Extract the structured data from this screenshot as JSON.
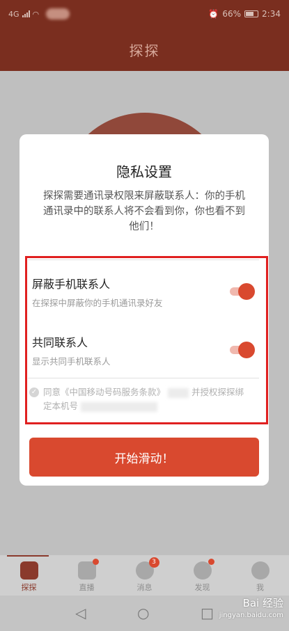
{
  "status_bar": {
    "network": "4G",
    "battery_percent": "66%",
    "time": "2:34"
  },
  "header": {
    "title": "探探"
  },
  "dialog": {
    "title": "隐私设置",
    "description": "探探需要通讯录权限来屏蔽联系人：你的手机通讯录中的联系人将不会看到你，你也看不到他们！",
    "settings": [
      {
        "label": "屏蔽手机联系人",
        "sub": "在探探中屏蔽你的手机通讯录好友",
        "enabled": true
      },
      {
        "label": "共同联系人",
        "sub": "显示共同手机联系人",
        "enabled": true
      }
    ],
    "agree_text": "同意《中国移动号码服务条款》",
    "agree_text2": "并授权探探绑",
    "agree_text3": "定本机号",
    "start_button": "开始滑动！"
  },
  "bottom_nav": [
    {
      "label": "探探",
      "icon": "cards-icon",
      "active": true
    },
    {
      "label": "直播",
      "icon": "tv-icon",
      "dot": true
    },
    {
      "label": "消息",
      "icon": "chat-icon",
      "badge": "3"
    },
    {
      "label": "发现",
      "icon": "compass-icon",
      "dot": true
    },
    {
      "label": "我",
      "icon": "profile-icon"
    }
  ],
  "watermark": {
    "brand": "Bai 经验",
    "url": "jingyan.baidu.com"
  },
  "colors": {
    "accent": "#d9492f",
    "header_bg": "#7a2e1f",
    "highlight_border": "#e02020"
  }
}
